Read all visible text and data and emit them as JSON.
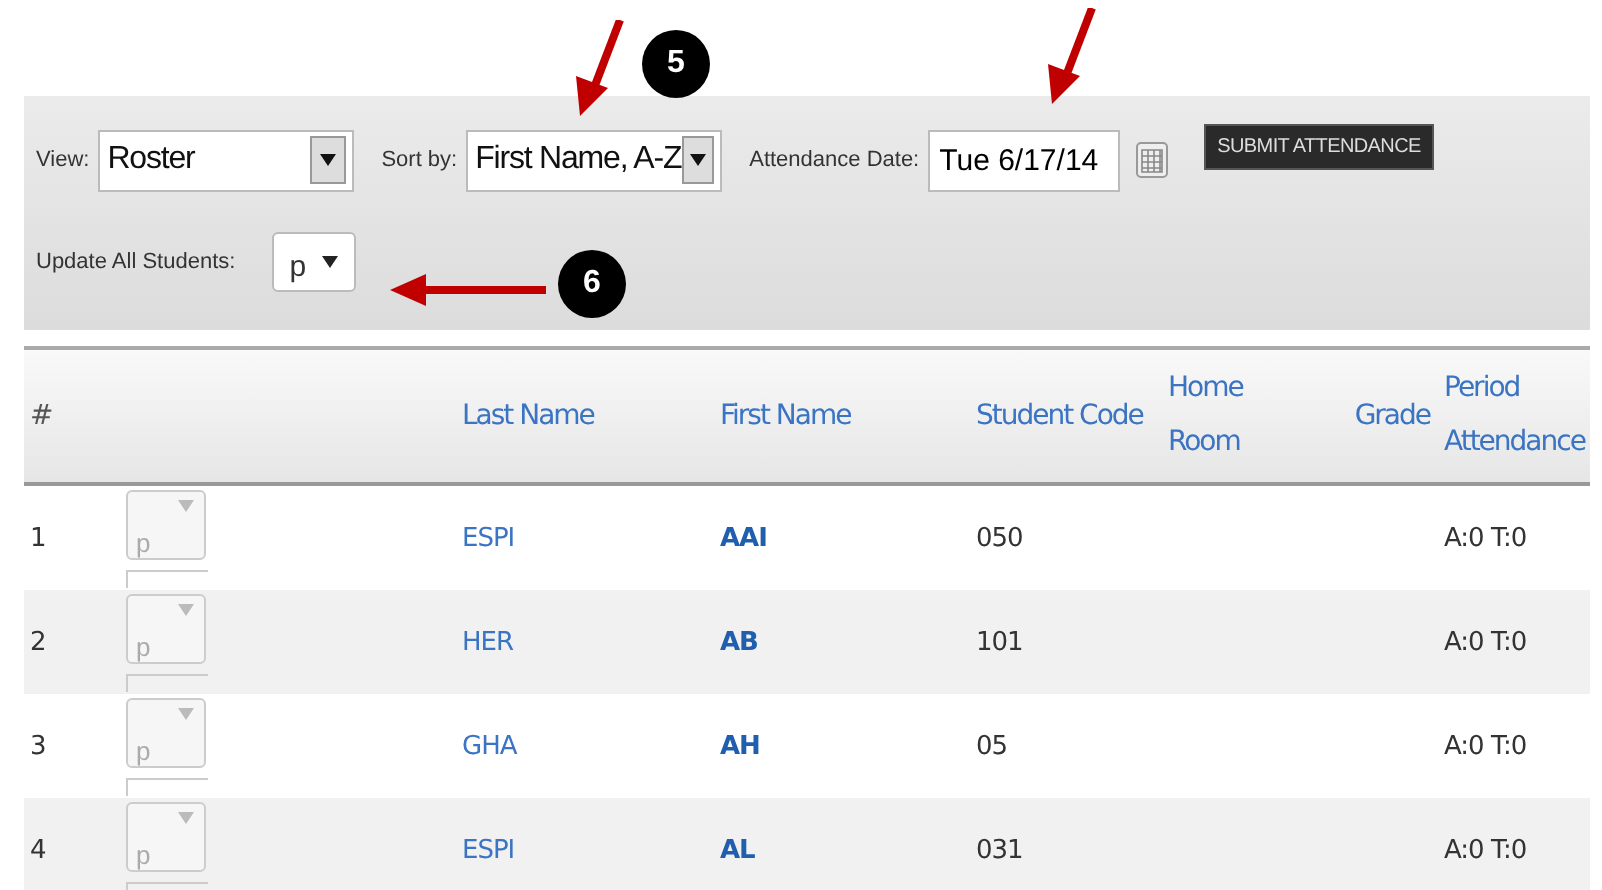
{
  "toolbar": {
    "view": {
      "label": "View:",
      "value": "Roster"
    },
    "sort": {
      "label": "Sort by:",
      "value": "First Name, A-Z"
    },
    "date": {
      "label": "Attendance Date:",
      "value": "Tue 6/17/14"
    },
    "submit": "SUBMIT ATTENDANCE",
    "update_all": {
      "label": "Update All Students:",
      "value": "p"
    }
  },
  "table": {
    "columns": [
      "#",
      "Last Name",
      "First Name",
      "Student Code",
      "Home Room",
      "Grade",
      "Period Attendance"
    ],
    "rows": [
      {
        "number": "1",
        "status": "p",
        "disabled": true,
        "last_name": "ESPI",
        "first_name": "AAI",
        "student_code": "050",
        "attendance": "A:0 T:0"
      },
      {
        "number": "2",
        "status": "p",
        "disabled": true,
        "last_name": "HER",
        "first_name": "AB",
        "student_code": "101",
        "attendance": "A:0 T:0"
      },
      {
        "number": "3",
        "status": "p",
        "disabled": true,
        "last_name": "GHA",
        "first_name": "AH",
        "student_code": "05",
        "attendance": "A:0 T:0"
      },
      {
        "number": "4",
        "status": "p",
        "disabled": true,
        "last_name": "ESPI",
        "first_name": "AL",
        "student_code": "031",
        "attendance": "A:0 T:0"
      }
    ]
  },
  "annotations": [
    {
      "kind": "arrow"
    },
    {
      "kind": "badge",
      "label": "5"
    },
    {
      "kind": "arrow"
    },
    {
      "kind": "arrow"
    },
    {
      "kind": "badge",
      "label": "6"
    }
  ]
}
